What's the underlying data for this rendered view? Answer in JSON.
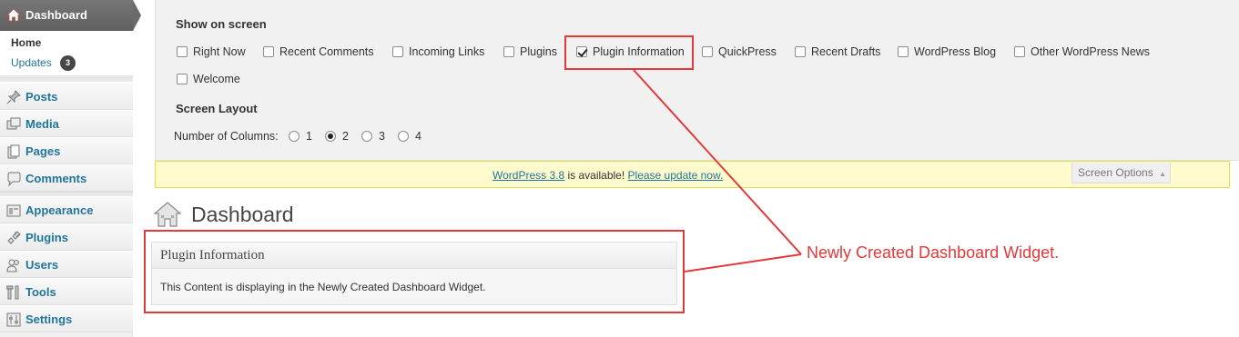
{
  "sidebar": {
    "current": {
      "label": "Dashboard",
      "icon": "house-icon"
    },
    "submenu": {
      "home": "Home",
      "updates": "Updates",
      "updates_count": "3"
    },
    "items": [
      {
        "label": "Posts",
        "icon": "pushpin-icon"
      },
      {
        "label": "Media",
        "icon": "media-icon"
      },
      {
        "label": "Pages",
        "icon": "pages-icon"
      },
      {
        "label": "Comments",
        "icon": "comment-bubble-icon"
      },
      {
        "label": "Appearance",
        "icon": "appearance-icon"
      },
      {
        "label": "Plugins",
        "icon": "plug-icon"
      },
      {
        "label": "Users",
        "icon": "users-icon"
      },
      {
        "label": "Tools",
        "icon": "tools-icon"
      },
      {
        "label": "Settings",
        "icon": "settings-icon"
      }
    ]
  },
  "screen_options": {
    "show_on_screen_heading": "Show on screen",
    "checkboxes": [
      {
        "label": "Right Now",
        "checked": false
      },
      {
        "label": "Recent Comments",
        "checked": false
      },
      {
        "label": "Incoming Links",
        "checked": false
      },
      {
        "label": "Plugins",
        "checked": false
      },
      {
        "label": "Plugin Information",
        "checked": true
      },
      {
        "label": "QuickPress",
        "checked": false
      },
      {
        "label": "Recent Drafts",
        "checked": false
      },
      {
        "label": "WordPress Blog",
        "checked": false
      },
      {
        "label": "Other WordPress News",
        "checked": false
      },
      {
        "label": "Welcome",
        "checked": false
      }
    ],
    "layout_heading": "Screen Layout",
    "columns_label": "Number of Columns:",
    "columns": [
      "1",
      "2",
      "3",
      "4"
    ],
    "columns_selected": "2",
    "tab_label": "Screen Options",
    "tab_arrow": "▲"
  },
  "notice": {
    "version_link": "WordPress 3.8",
    "middle_text": " is available! ",
    "update_link": "Please update now."
  },
  "page": {
    "title": "Dashboard"
  },
  "widget": {
    "title": "Plugin Information",
    "content": "This Content is displaying in the Newly Created Dashboard Widget."
  },
  "annotation": {
    "text": "Newly Created Dashboard Widget.",
    "color": "#e03a3a"
  },
  "colors": {
    "link": "#21759b",
    "notice_bg": "#fffbcc",
    "sidebar_current": "#6a6a6a"
  }
}
